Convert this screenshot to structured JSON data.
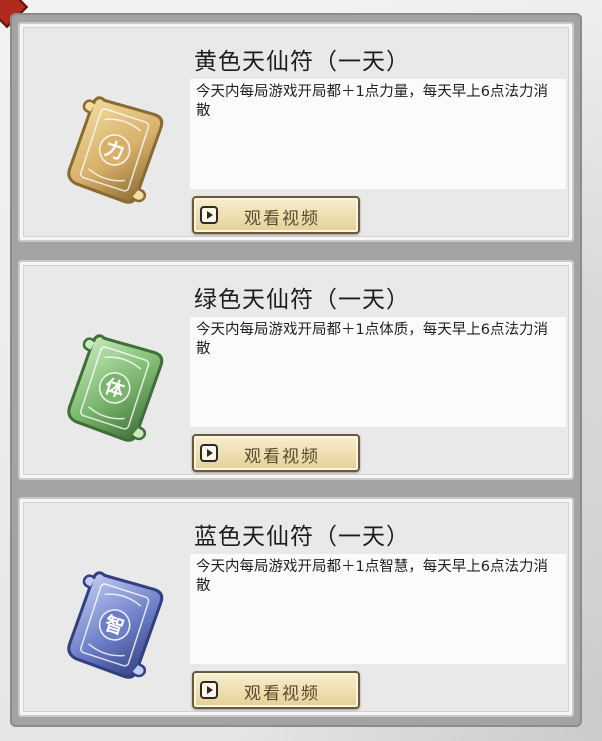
{
  "items": [
    {
      "title": "黄色天仙符（一天）",
      "description": "今天内每局游戏开局都＋1点力量，每天早上6点法力消散",
      "glyph": "力",
      "button_label": "观看视频",
      "color_light": "#f3dca0",
      "color_mid": "#d8b06a",
      "color_dark": "#8a6a33",
      "icon": "yellow-talisman-scroll-icon"
    },
    {
      "title": "绿色天仙符（一天）",
      "description": "今天内每局游戏开局都＋1点体质，每天早上6点法力消散",
      "glyph": "体",
      "button_label": "观看视频",
      "color_light": "#c9ebbd",
      "color_mid": "#79b56c",
      "color_dark": "#3f6f38",
      "icon": "green-talisman-scroll-icon"
    },
    {
      "title": "蓝色天仙符（一天）",
      "description": "今天内每局游戏开局都＋1点智慧，每天早上6点法力消散",
      "glyph": "智",
      "button_label": "观看视频",
      "color_light": "#c3cdf2",
      "color_mid": "#6d7fc9",
      "color_dark": "#343f80",
      "icon": "blue-talisman-scroll-icon"
    }
  ]
}
